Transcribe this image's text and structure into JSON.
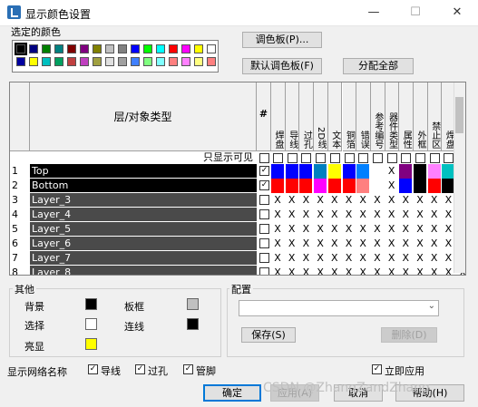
{
  "window": {
    "title": "显示颜色设置",
    "minimize": "—",
    "maximize": "☐",
    "close": "✕"
  },
  "palette": {
    "label": "选定的颜色",
    "row1": [
      "#000000",
      "#000080",
      "#008000",
      "#008080",
      "#800000",
      "#800080",
      "#808000",
      "#c0c0c0",
      "#808080",
      "#0000ff",
      "#00ff00",
      "#00ffff",
      "#ff0000",
      "#ff00ff",
      "#ffff00",
      "#ffffff"
    ],
    "row2": [
      "#0000a0",
      "#ffff00",
      "#00c0c0",
      "#00a060",
      "#c04040",
      "#c040c0",
      "#a0a040",
      "#e0e0e0",
      "#a0a0a0",
      "#4080ff",
      "#80ff80",
      "#80ffff",
      "#ff8080",
      "#ff80ff",
      "#ffff80",
      "#ff8080"
    ],
    "selected_index": 0
  },
  "buttons": {
    "palette": "调色板(P)...",
    "default_palette": "默认调色板(F)",
    "assign_all": "分配全部",
    "save": "保存(S)",
    "delete": "删除(D)",
    "ok": "确定",
    "apply": "应用(A)",
    "cancel": "取消",
    "help": "帮助(H)"
  },
  "table": {
    "header_title": "层/对象类型",
    "hash": "#",
    "columns": [
      "焊盘",
      "导线",
      "过孔",
      "2D线",
      "文本",
      "铜箔",
      "错误",
      "参考编号",
      "器件类型",
      "属性",
      "外框",
      "禁止区",
      "焊盘",
      "板框"
    ],
    "visible_only_label": "只显示可见",
    "rows": [
      {
        "num": "1",
        "name": "Top",
        "checked": true,
        "colors": [
          "#0000ff",
          "#0000ff",
          "#0000ff",
          "#0080c0",
          "#ffff00",
          "#0000ff",
          "#0080ff",
          "#ffffff",
          "X",
          "#800080",
          "#000000",
          "#ff80ff",
          "#00c0c0",
          "#000000"
        ]
      },
      {
        "num": "2",
        "name": "Bottom",
        "checked": true,
        "colors": [
          "#ff0000",
          "#ff0000",
          "#ff0000",
          "#ff00ff",
          "#ff0000",
          "#ff0000",
          "#ff8080",
          "#ffffff",
          "X",
          "#0000ff",
          "#000000",
          "#ff0000",
          "#000000",
          "#80ffff"
        ]
      },
      {
        "num": "3",
        "name": "Layer_3",
        "checked": false,
        "colors": []
      },
      {
        "num": "4",
        "name": "Layer_4",
        "checked": false,
        "colors": []
      },
      {
        "num": "5",
        "name": "Layer_5",
        "checked": false,
        "colors": []
      },
      {
        "num": "6",
        "name": "Layer_6",
        "checked": false,
        "colors": []
      },
      {
        "num": "7",
        "name": "Layer_7",
        "checked": false,
        "colors": []
      },
      {
        "num": "8",
        "name": "Layer_8",
        "checked": false,
        "colors": []
      }
    ]
  },
  "other": {
    "label": "其他",
    "background": {
      "label": "背景",
      "color": "#000000"
    },
    "board_frame": {
      "label": "板框",
      "color": "#c0c0c0"
    },
    "selection": {
      "label": "选择",
      "color": "#ffffff"
    },
    "connection": {
      "label": "连线",
      "color": "#000000"
    },
    "highlight": {
      "label": "亮显",
      "color": "#ffff00"
    }
  },
  "config": {
    "label": "配置",
    "selected": ""
  },
  "net_names": {
    "label": "显示网络名称",
    "trace": "导线",
    "via": "过孔",
    "pin": "管脚"
  },
  "apply_immediately": "立即应用",
  "watermark": "CSDN @ZhangZandZhang"
}
